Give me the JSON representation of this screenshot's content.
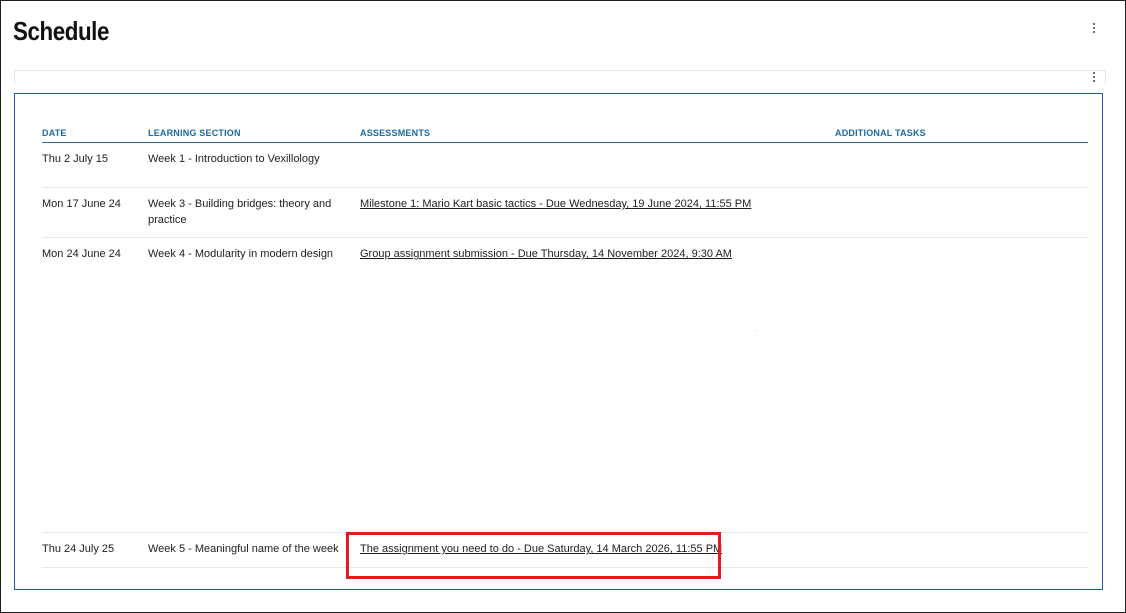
{
  "page": {
    "title": "Schedule"
  },
  "menus": {
    "top_icon": "more-vertical-icon",
    "inner_icon": "more-vertical-icon"
  },
  "table": {
    "headers": {
      "date": "DATE",
      "section": "LEARNING SECTION",
      "assessments": "ASSESSMENTS",
      "additional": "ADDITIONAL TASKS"
    },
    "rows": [
      {
        "date": "Thu 2 July 15",
        "section": "Week 1 - Introduction to Vexillology",
        "assessment": "",
        "additional": ""
      },
      {
        "date": "Mon 17 June 24",
        "section": "Week 3 - Building bridges: theory and practice",
        "assessment": "Milestone 1: Mario Kart basic tactics - Due Wednesday, 19 June 2024, 11:55 PM",
        "additional": ""
      },
      {
        "date": "Mon 24 June 24",
        "section": "Week 4 - Modularity in modern design",
        "assessment": "Group assignment submission - Due Thursday, 14 November 2024, 9:30 AM",
        "additional": ""
      },
      {
        "date": "Thu 24 July 25",
        "section": "Week 5 - Meaningful name of the week",
        "assessment": "The assignment you need to do - Due Saturday, 14 March 2026, 11:55 PM",
        "additional": ""
      }
    ]
  },
  "colors": {
    "header_text": "#1a6aa3",
    "table_border": "#1a5e9e",
    "highlight": "#e31b1b"
  }
}
